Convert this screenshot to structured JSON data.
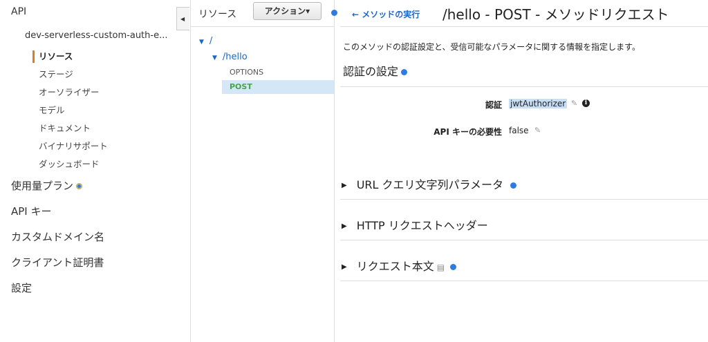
{
  "nav": {
    "api_label": "API",
    "api_name": "dev-serverless-custom-auth-e...",
    "sub_items": [
      {
        "label": "リソース",
        "active": true
      },
      {
        "label": "ステージ"
      },
      {
        "label": "オーソライザー"
      },
      {
        "label": "モデル"
      },
      {
        "label": "ドキュメント"
      },
      {
        "label": "バイナリサポート"
      },
      {
        "label": "ダッシュボード"
      }
    ],
    "main_items": [
      {
        "label": "使用量プラン",
        "dot": true
      },
      {
        "label": "API キー"
      },
      {
        "label": "カスタムドメイン名"
      },
      {
        "label": "クライアント証明書"
      },
      {
        "label": "設定"
      }
    ]
  },
  "resources": {
    "title": "リソース",
    "actions_button": "アクション▾",
    "root": "/",
    "child": "/hello",
    "methods": [
      "OPTIONS",
      "POST"
    ],
    "selected_method": "POST"
  },
  "main": {
    "back_link": "← メソッドの実行",
    "title": "/hello - POST - メソッドリクエスト",
    "description": "このメソッドの認証設定と、受信可能なパラメータに関する情報を指定します。",
    "auth_section_title": "認証の設定",
    "auth_label": "認証",
    "auth_value": "jwtAuthorizer",
    "api_key_label": "API キーの必要性",
    "api_key_value": "false",
    "expanders": [
      {
        "label": "URL クエリ文字列パラメータ",
        "dot": true
      },
      {
        "label": "HTTP リクエストヘッダー",
        "dot": false
      },
      {
        "label": "リクエスト本文",
        "dot": true,
        "book": true
      }
    ]
  },
  "colors": {
    "accent_blue": "#2f7bde",
    "link_blue": "#1a66c9",
    "active_orange": "#e07b25",
    "post_green": "#47a447",
    "selection_bg": "#d3e7f7"
  }
}
